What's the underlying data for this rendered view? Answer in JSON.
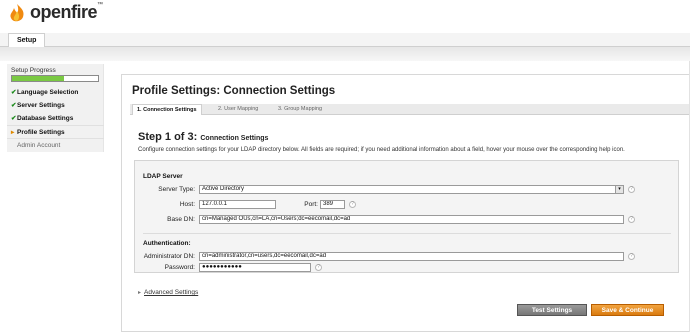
{
  "app": {
    "name": "openfire",
    "tm": "™"
  },
  "tabs": [
    {
      "label": "Setup"
    }
  ],
  "sidebar": {
    "progress_label": "Setup Progress",
    "progress": 0.6,
    "items": [
      {
        "label": "Language Selection",
        "status": "done",
        "mark": "✔"
      },
      {
        "label": "Server Settings",
        "status": "done",
        "mark": "✔"
      },
      {
        "label": "Database Settings",
        "status": "done",
        "mark": "✔"
      },
      {
        "label": "Profile Settings",
        "status": "current",
        "mark": "▸"
      },
      {
        "label": "Admin Account",
        "status": "pending",
        "mark": ""
      }
    ]
  },
  "main": {
    "title": "Profile Settings: Connection Settings",
    "subtabs": [
      {
        "label": "1. Connection Settings",
        "active": true
      },
      {
        "label": "2. User Mapping",
        "active": false
      },
      {
        "label": "3. Group Mapping",
        "active": false
      }
    ],
    "step_heading": "Step 1 of 3:",
    "step_subheading": "Connection Settings",
    "intro": "Configure connection settings for your LDAP directory below. All fields are required; if you need additional information about a field, hover your mouse over the corresponding help icon.",
    "ldap_section": "LDAP Server",
    "server_type_label": "Server Type:",
    "server_type_value": "Active Directory",
    "host_label": "Host:",
    "host_value": "127.0.0.1",
    "port_label": "Port:",
    "port_value": "389",
    "base_dn_label": "Base DN:",
    "base_dn_value": "cn=Managed OUs,cn=LA,cn=Users;dc=eecomail,dc=ad",
    "auth_section": "Authentication:",
    "admin_dn_label": "Administrator DN:",
    "admin_dn_value": "cn=administrator,cn=users,dc=eecomail,dc=ad",
    "password_label": "Password:",
    "password_value": "●●●●●●●●●●●",
    "help_glyph": "?",
    "select_arrow_glyph": "▾",
    "advanced_arrow": "▸",
    "advanced_label": "Advanced Settings",
    "test_button": "Test Settings",
    "save_button": "Save & Continue"
  },
  "colors": {
    "accent": "#e08a00",
    "progress": "#7ac943",
    "save": "#d97b10"
  }
}
